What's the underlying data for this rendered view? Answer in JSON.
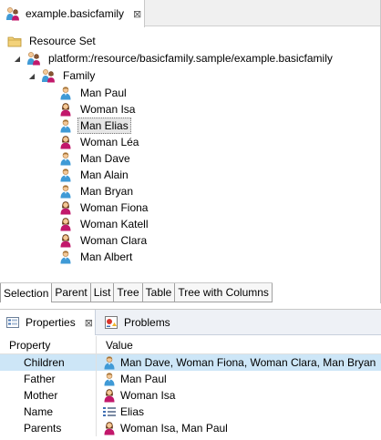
{
  "editor": {
    "tab_title": "example.basicfamily",
    "tree": {
      "root_label": "Resource Set",
      "resource_label": "platform:/resource/basicfamily.sample/example.basicfamily",
      "family_label": "Family",
      "members": [
        {
          "label": "Man Paul",
          "gender": "man"
        },
        {
          "label": "Woman Isa",
          "gender": "woman"
        },
        {
          "label": "Man Elias",
          "gender": "man",
          "selected": true
        },
        {
          "label": "Woman Léa",
          "gender": "woman"
        },
        {
          "label": "Man Dave",
          "gender": "man"
        },
        {
          "label": "Man Alain",
          "gender": "man"
        },
        {
          "label": "Man Bryan",
          "gender": "man"
        },
        {
          "label": "Woman Fiona",
          "gender": "woman"
        },
        {
          "label": "Woman Katell",
          "gender": "woman"
        },
        {
          "label": "Woman Clara",
          "gender": "woman"
        },
        {
          "label": "Man Albert",
          "gender": "man"
        }
      ]
    },
    "page_tabs": [
      "Selection",
      "Parent",
      "List",
      "Tree",
      "Table",
      "Tree with Columns"
    ]
  },
  "properties_view": {
    "tab_label": "Properties",
    "other_tab_label": "Problems",
    "columns": [
      "Property",
      "Value"
    ],
    "rows": [
      {
        "property": "Children",
        "value": "Man Dave, Woman Fiona, Woman Clara, Man Bryan",
        "icon": "man",
        "selected": true
      },
      {
        "property": "Father",
        "value": "Man Paul",
        "icon": "man"
      },
      {
        "property": "Mother",
        "value": "Woman Isa",
        "icon": "woman"
      },
      {
        "property": "Name",
        "value": "Elias",
        "icon": "text-property"
      },
      {
        "property": "Parents",
        "value": "Woman Isa, Man Paul",
        "icon": "woman"
      }
    ]
  },
  "colors": {
    "man_shirt": "#3f9ad6",
    "woman_shirt": "#c2186b",
    "skin": "#f4c898",
    "selection_bg": "#cde6f7"
  }
}
